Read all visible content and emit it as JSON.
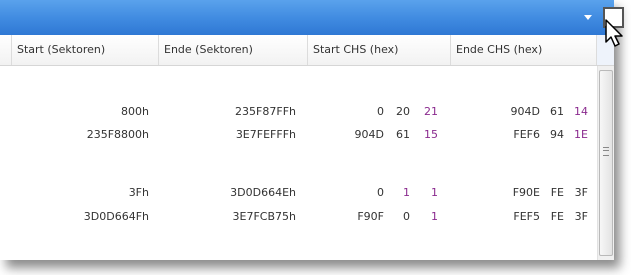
{
  "header": {
    "columns": [
      "Start (Sektoren)",
      "Ende (Sektoren)",
      "Start CHS (hex)",
      "Ende CHS (hex)"
    ]
  },
  "rows": [
    {
      "start": "800h",
      "end": "235F87FFh",
      "start_chs": [
        "0",
        "20",
        "21"
      ],
      "end_chs": [
        "904D",
        "61",
        "14"
      ]
    },
    {
      "start": "235F8800h",
      "end": "3E7FEFFFh",
      "start_chs": [
        "904D",
        "61",
        "15"
      ],
      "end_chs": [
        "FEF6",
        "94",
        "1E"
      ]
    },
    {
      "start": "3Fh",
      "end": "3D0D664Eh",
      "start_chs": [
        "0",
        "1",
        "1"
      ],
      "end_chs": [
        "F90E",
        "FE",
        "3F"
      ]
    },
    {
      "start": "3D0D664Fh",
      "end": "3E7FCB75h",
      "start_chs": [
        "F90F",
        "0",
        "1"
      ],
      "end_chs": [
        "FEF5",
        "FE",
        "3F"
      ]
    }
  ],
  "icons": {
    "dropdown": "chevron-down-icon",
    "column_chooser": "column-chooser-button",
    "cursor": "mouse-pointer-icon"
  },
  "colors": {
    "title_bar": "#3f8ae0",
    "sector_value": "#8a2a8e"
  }
}
